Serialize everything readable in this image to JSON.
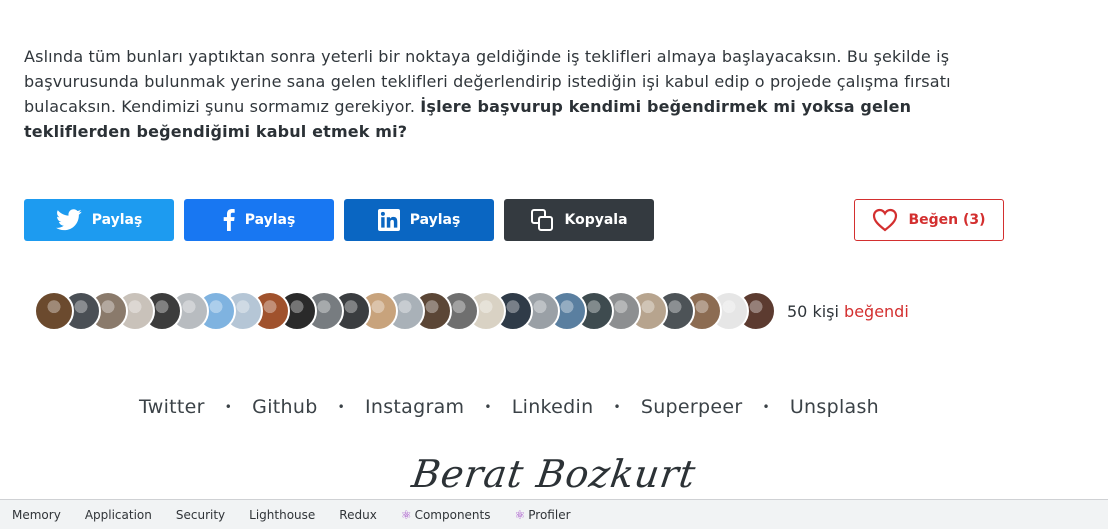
{
  "article": {
    "text": "Aslında tüm bunları yaptıktan sonra yeterli bir noktaya geldiğinde iş teklifleri almaya başlayacaksın. Bu şekilde iş başvurusunda bulunmak yerine sana gelen teklifleri değerlendirip istediğin işi kabul edip o projede çalışma fırsatı bulacaksın. Kendimizi şunu sormamız gerekiyor. ",
    "bold_question": "İşlere başvurup kendimi beğendirmek mi yoksa gelen tekliflerden beğendiğimi kabul etmek mi?"
  },
  "share": {
    "twitter_label": "Paylaş",
    "facebook_label": "Paylaş",
    "linkedin_label": "Paylaş",
    "copy_label": "Kopyala",
    "like_label": "Beğen (3)"
  },
  "colors": {
    "twitter": "#1d9bf0",
    "facebook": "#1877f2",
    "linkedin": "#0a66c2",
    "copy": "#343a40",
    "like_accent": "#d32f2f"
  },
  "likers": {
    "avatar_colors": [
      "#6b4a2e",
      "#4a4f55",
      "#8a7a6b",
      "#c9c2ba",
      "#3c3c3c",
      "#b8bcc0",
      "#7fb3e0",
      "#b5c6d6",
      "#a0522d",
      "#2a2a2a",
      "#777c80",
      "#3a3d40",
      "#c8a37c",
      "#a9b1b8",
      "#5b4636",
      "#6f6f6f",
      "#d9d2c4",
      "#2f3b48",
      "#9aa0a6",
      "#5a7fa0",
      "#3e4b4f",
      "#8d8f91",
      "#b7a48e",
      "#4d5357",
      "#8c6c52",
      "#e6e6e6",
      "#5c3b30"
    ],
    "count_text": "50 kişi",
    "action_text": "beğendi"
  },
  "social_links": [
    "Twitter",
    "Github",
    "Instagram",
    "Linkedin",
    "Superpeer",
    "Unsplash"
  ],
  "separator": "•",
  "signature": "Berat Bozkurt",
  "devtools_tabs": [
    "Memory",
    "Application",
    "Security",
    "Lighthouse",
    "Redux",
    "Components",
    "Profiler"
  ]
}
